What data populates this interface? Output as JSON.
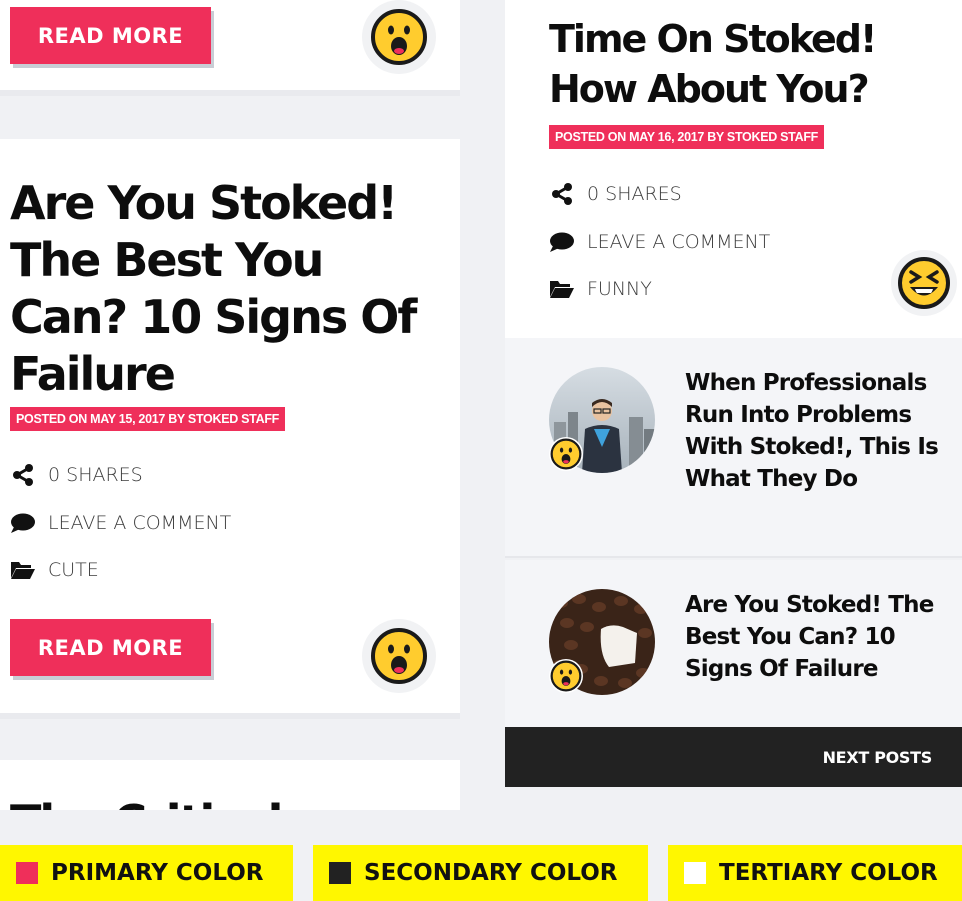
{
  "colors": {
    "primary": "#ef2f5a",
    "secondary": "#222222",
    "tertiary": "#ffffff",
    "legend_bg": "#fff700"
  },
  "left": {
    "top_card": {
      "button_label": "READ MORE",
      "reaction_icon": "surprised-face-icon"
    },
    "post": {
      "title_lines": [
        "Are You Stoked!",
        "The Best You",
        "Can? 10 Signs Of",
        "Failure"
      ],
      "posted": "POSTED ON MAY 15, 2017 BY STOKED STAFF",
      "shares": "0 SHARES",
      "comment": "LEAVE A COMMENT",
      "category": "CUTE",
      "button_label": "READ MORE",
      "reaction_icon": "surprised-face-icon"
    },
    "next_post_title": "The Critical"
  },
  "right": {
    "post": {
      "title_lines": [
        "Time On Stoked!",
        "How About You?"
      ],
      "posted": "POSTED ON MAY 16, 2017 BY STOKED STAFF",
      "shares": "0 SHARES",
      "comment": "LEAVE A COMMENT",
      "category": "FUNNY",
      "reaction_icon": "laughing-face-icon"
    },
    "related": [
      {
        "title": "When Professionals Run Into Problems With Stoked!, This Is What They Do",
        "thumb": "businessman-photo",
        "reaction_icon": "surprised-face-icon"
      },
      {
        "title": "Are You Stoked! The Best You Can? 10 Signs Of Failure",
        "thumb": "coffee-beans-photo",
        "reaction_icon": "surprised-face-icon"
      }
    ],
    "next_posts_label": "NEXT POSTS"
  },
  "legend": [
    {
      "label": "PRIMARY COLOR",
      "color": "#ef2f5a"
    },
    {
      "label": "SECONDARY COLOR",
      "color": "#222222"
    },
    {
      "label": "TERTIARY COLOR",
      "color": "#ffffff"
    }
  ]
}
